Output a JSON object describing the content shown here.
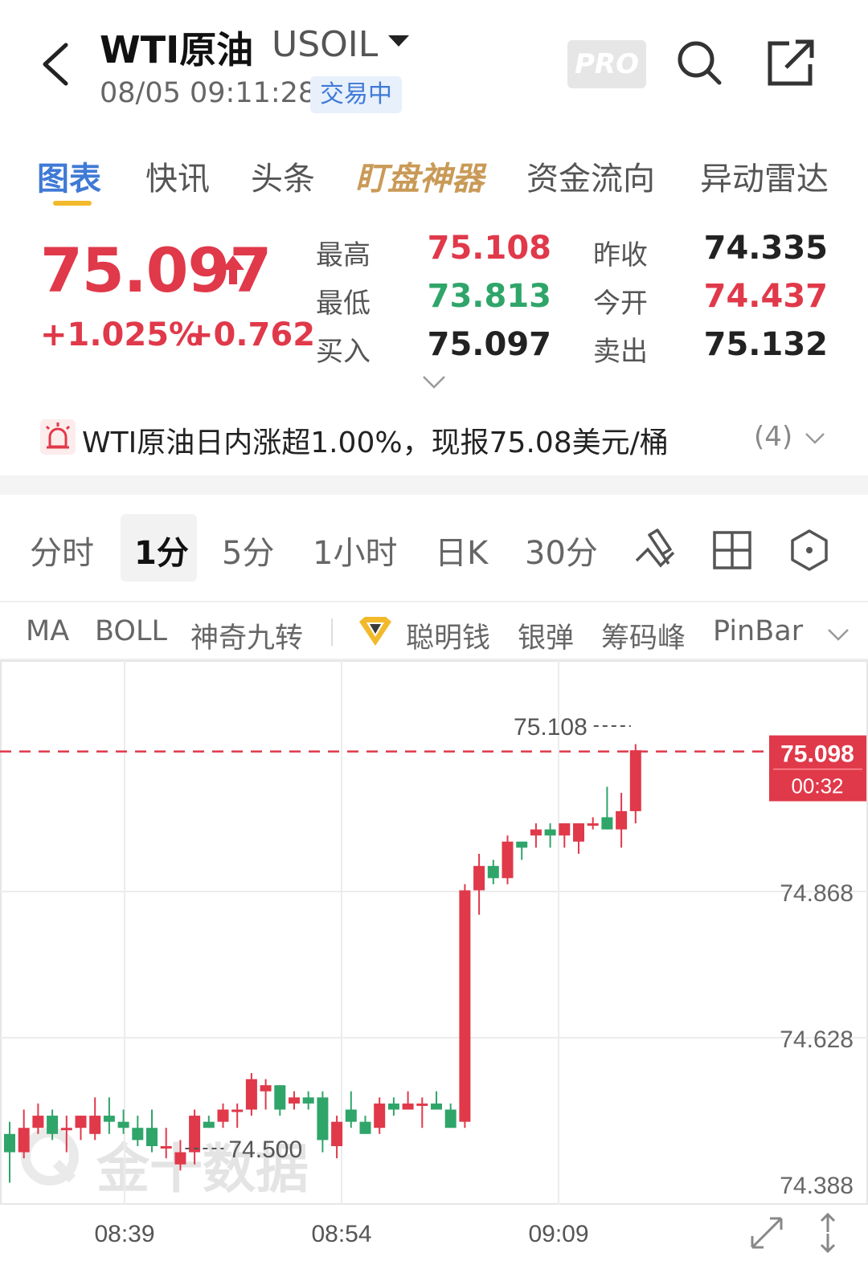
{
  "header": {
    "title": "WTI原油",
    "code": "USOIL",
    "timestamp": "08/05 09:11:28",
    "status": "交易中",
    "pro_label": "PRO"
  },
  "tabs": [
    {
      "label": "图表",
      "active": true
    },
    {
      "label": "快讯"
    },
    {
      "label": "头条"
    },
    {
      "label": "盯盘神器",
      "special": true
    },
    {
      "label": "资金流向"
    },
    {
      "label": "异动雷达"
    }
  ],
  "quote": {
    "price": "75.097",
    "change_pct": "+1.025%",
    "change_abs": "+0.762",
    "high_label": "最高",
    "high": "75.108",
    "low_label": "最低",
    "low": "73.813",
    "bid_label": "买入",
    "bid": "75.097",
    "prev_close_label": "昨收",
    "prev_close": "74.335",
    "open_label": "今开",
    "open": "74.437",
    "ask_label": "卖出",
    "ask": "75.132"
  },
  "news": {
    "text": "WTI原油日内涨超1.00%，现报75.08美元/桶",
    "count": "(4)"
  },
  "periods": [
    {
      "label": "分时"
    },
    {
      "label": "1分",
      "active": true
    },
    {
      "label": "5分"
    },
    {
      "label": "1小时"
    },
    {
      "label": "日K"
    },
    {
      "label": "30分"
    }
  ],
  "indicators": [
    "MA",
    "BOLL",
    "神奇九转",
    "聪明钱",
    "银弹",
    "筹码峰",
    "PinBar"
  ],
  "watermark": "金十数据",
  "colors": {
    "up": "#e0394a",
    "down": "#2fa56a",
    "accent": "#3f7ad6",
    "gold": "#f2b92a"
  },
  "chart_data": {
    "type": "candlestick",
    "x_ticks": [
      "08:39",
      "08:54",
      "09:09"
    ],
    "y_ticks": [
      "75.108",
      "74.868",
      "74.628",
      "74.388"
    ],
    "ylim": [
      74.388,
      75.108
    ],
    "high_marker": "75.108",
    "low_marker": "74.500",
    "current_price": "75.098",
    "countdown": "00:32",
    "candles": [
      [
        74.47,
        74.44,
        74.49,
        74.39
      ],
      [
        74.44,
        74.48,
        74.51,
        74.43
      ],
      [
        74.48,
        74.5,
        74.52,
        74.47
      ],
      [
        74.5,
        74.47,
        74.51,
        74.46
      ],
      [
        74.48,
        74.48,
        74.5,
        74.44
      ],
      [
        74.48,
        74.5,
        74.5,
        74.46
      ],
      [
        74.47,
        74.5,
        74.53,
        74.46
      ],
      [
        74.5,
        74.49,
        74.53,
        74.47
      ],
      [
        74.49,
        74.48,
        74.51,
        74.47
      ],
      [
        74.48,
        74.46,
        74.5,
        74.45
      ],
      [
        74.48,
        74.45,
        74.51,
        74.44
      ],
      [
        74.45,
        74.45,
        74.48,
        74.43
      ],
      [
        74.42,
        74.44,
        74.46,
        74.41
      ],
      [
        74.44,
        74.5,
        74.51,
        74.42
      ],
      [
        74.49,
        74.48,
        74.5,
        74.48
      ],
      [
        74.49,
        74.51,
        74.52,
        74.48
      ],
      [
        74.51,
        74.51,
        74.52,
        74.48
      ],
      [
        74.51,
        74.56,
        74.57,
        74.5
      ],
      [
        74.54,
        74.55,
        74.56,
        74.51
      ],
      [
        74.55,
        74.51,
        74.55,
        74.5
      ],
      [
        74.52,
        74.53,
        74.54,
        74.51
      ],
      [
        74.53,
        74.52,
        74.54,
        74.51
      ],
      [
        74.53,
        74.46,
        74.54,
        74.44
      ],
      [
        74.45,
        74.49,
        74.5,
        74.43
      ],
      [
        74.51,
        74.49,
        74.54,
        74.48
      ],
      [
        74.49,
        74.47,
        74.5,
        74.47
      ],
      [
        74.48,
        74.52,
        74.53,
        74.47
      ],
      [
        74.52,
        74.51,
        74.53,
        74.5
      ],
      [
        74.51,
        74.52,
        74.54,
        74.51
      ],
      [
        74.52,
        74.52,
        74.53,
        74.48
      ],
      [
        74.52,
        74.51,
        74.54,
        74.51
      ],
      [
        74.51,
        74.48,
        74.52,
        74.48
      ],
      [
        74.49,
        74.87,
        74.88,
        74.48
      ],
      [
        74.87,
        74.91,
        74.93,
        74.83
      ],
      [
        74.91,
        74.89,
        74.92,
        74.88
      ],
      [
        74.89,
        74.95,
        74.96,
        74.88
      ],
      [
        74.95,
        74.94,
        74.95,
        74.92
      ],
      [
        74.96,
        74.97,
        74.98,
        74.94
      ],
      [
        74.97,
        74.96,
        74.98,
        74.94
      ],
      [
        74.96,
        74.98,
        74.98,
        74.94
      ],
      [
        74.95,
        74.98,
        74.98,
        74.93
      ],
      [
        74.98,
        74.98,
        74.99,
        74.97
      ],
      [
        74.99,
        74.97,
        75.04,
        74.97
      ],
      [
        74.97,
        75.0,
        75.03,
        74.94
      ],
      [
        75.0,
        75.1,
        75.11,
        74.98
      ]
    ]
  }
}
